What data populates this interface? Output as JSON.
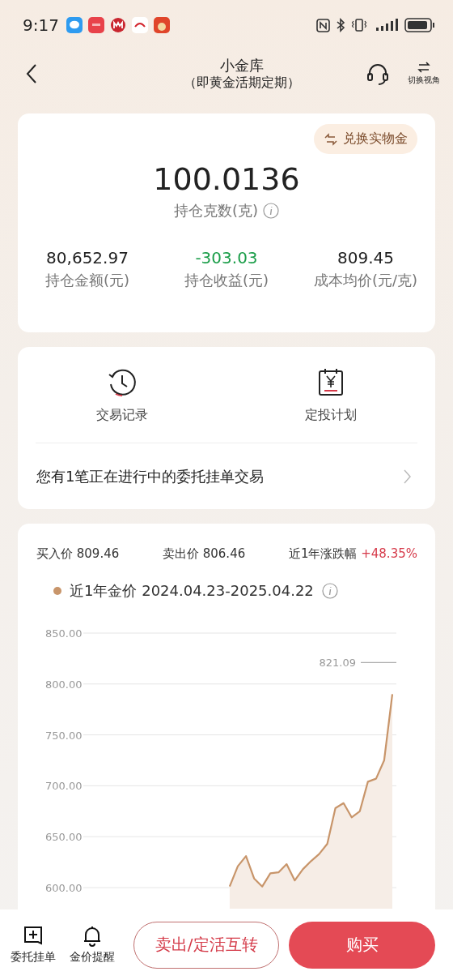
{
  "status_bar": {
    "time": "9:17"
  },
  "header": {
    "title": "小金库",
    "subtitle": "（即黄金活期定期）",
    "switch_label": "切换视角"
  },
  "holdings": {
    "exchange_button": "兑换实物金",
    "grams": "100.0136",
    "grams_label": "持仓克数(克)",
    "stats": [
      {
        "value": "80,652.97",
        "label": "持仓金额(元)",
        "kind": "neutral"
      },
      {
        "value": "-303.03",
        "label": "持仓收益(元)",
        "kind": "loss"
      },
      {
        "value": "809.45",
        "label": "成本均价(元/克)",
        "kind": "neutral"
      }
    ]
  },
  "shortcuts": [
    {
      "label": "交易记录",
      "kind": "history"
    },
    {
      "label": "定投计划",
      "kind": "calendar"
    }
  ],
  "pending_notice": "您有1笔正在进行中的委托挂单交易",
  "prices": [
    {
      "label": "买入价",
      "value": "809.46",
      "kind": "neutral"
    },
    {
      "label": "卖出价",
      "value": "806.46",
      "kind": "neutral"
    },
    {
      "label": "近1年涨跌幅",
      "value": "+48.35%",
      "kind": "gain"
    }
  ],
  "chart": {
    "date_range": "2024.04.23-2025.04.22",
    "chart_data": {
      "type": "area",
      "grid": true,
      "ylim": [
        600,
        850
      ],
      "yticks": [
        {
          "value": 850,
          "label": "850.00"
        },
        {
          "value": 800,
          "label": "800.00"
        },
        {
          "value": 750,
          "label": "750.00"
        },
        {
          "value": 700,
          "label": "700.00"
        },
        {
          "value": 650,
          "label": "650.00"
        },
        {
          "value": 600,
          "label": "600.00"
        }
      ],
      "series": [
        {
          "name": "近1年金价",
          "color": "#c8956a",
          "values": [
            null,
            null,
            null,
            null,
            null,
            null,
            null,
            null,
            null,
            null,
            null,
            null,
            null,
            null,
            null,
            null,
            null,
            null,
            601,
            621,
            631,
            609,
            601,
            614,
            615,
            623,
            607,
            618,
            626,
            633,
            643,
            678,
            683,
            669,
            675,
            704,
            707,
            725,
            790
          ]
        }
      ],
      "annotations": [
        {
          "text": "821.09"
        }
      ]
    }
  },
  "bottom_bar": {
    "tools": [
      {
        "label": "委托挂单",
        "kind": "order"
      },
      {
        "label": "金价提醒",
        "kind": "bell"
      }
    ],
    "secondary_button": "卖出/定活互转",
    "primary_button": "购买"
  }
}
